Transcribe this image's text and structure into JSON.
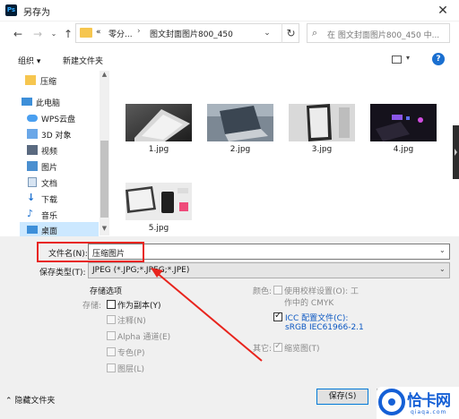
{
  "window": {
    "title": "另存为",
    "app_icon": "Ps"
  },
  "nav": {
    "breadcrumb": [
      "«",
      "零分...",
      "图文封面图片800_450"
    ],
    "search_placeholder": "在 图文封面图片800_450 中..."
  },
  "toolbar": {
    "organize": "组织 ▾",
    "new_folder": "新建文件夹"
  },
  "sidebar": {
    "items": [
      {
        "label": "压缩",
        "icon": "folder-icon"
      },
      {
        "label": "此电脑",
        "icon": "computer-icon"
      },
      {
        "label": "WPS云盘",
        "icon": "cloud-icon"
      },
      {
        "label": "3D 对象",
        "icon": "3d-objects-icon"
      },
      {
        "label": "视频",
        "icon": "video-icon"
      },
      {
        "label": "图片",
        "icon": "pictures-icon"
      },
      {
        "label": "文档",
        "icon": "documents-icon"
      },
      {
        "label": "下载",
        "icon": "download-icon"
      },
      {
        "label": "音乐",
        "icon": "music-icon"
      },
      {
        "label": "桌面",
        "icon": "desktop-icon"
      }
    ],
    "selected_index": 9
  },
  "files": [
    {
      "name": "1.jpg"
    },
    {
      "name": "2.jpg"
    },
    {
      "name": "3.jpg"
    },
    {
      "name": "4.jpg"
    },
    {
      "name": "5.jpg"
    }
  ],
  "form": {
    "filename_label": "文件名(N):",
    "filename_value": "压缩图片",
    "filetype_label": "保存类型(T):",
    "filetype_value": "JPEG (*.JPG;*.JPEG;*.JPE)"
  },
  "options": {
    "section_title": "存储选项",
    "storage_label": "存储:",
    "as_copy": "作为副本(Y)",
    "notes": "注释(N)",
    "alpha": "Alpha 通道(E)",
    "spot": "专色(P)",
    "layers": "图层(L)",
    "color_label": "颜色:",
    "proof": "使用校样设置(O): 工",
    "proof_line2": "作中的 CMYK",
    "icc": "ICC 配置文件(C):",
    "icc_line2": "sRGB IEC61966-2.1",
    "other_label": "其它:",
    "thumbnail": "缩览图(T)",
    "icc_checked": true,
    "thumbnail_checked": true
  },
  "footer": {
    "hide_folders": "隐藏文件夹",
    "save": "保存(S)"
  },
  "watermark": {
    "text": "恰卡网",
    "url": "qiaqa.com"
  },
  "colors": {
    "accent": "#0078d7",
    "highlight": "#e8241d",
    "selection": "#cce8ff",
    "brand": "#1560d6"
  }
}
